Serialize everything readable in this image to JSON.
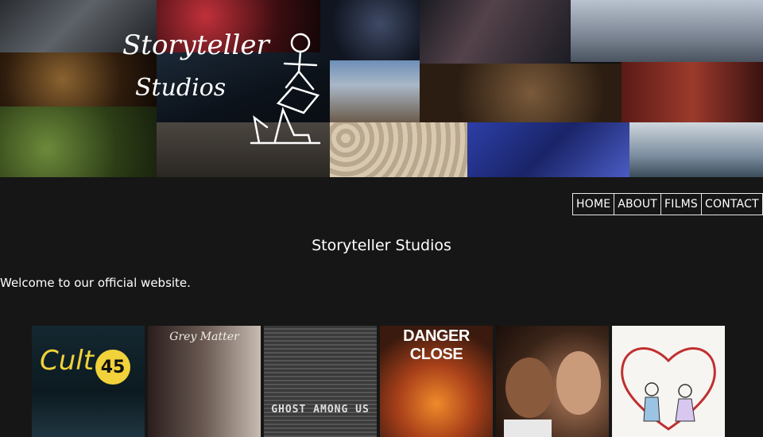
{
  "header": {
    "logo_line1": "Storyteller",
    "logo_line2": "Studios"
  },
  "nav": {
    "items": [
      {
        "label": "HOME"
      },
      {
        "label": "ABOUT"
      },
      {
        "label": "FILMS"
      },
      {
        "label": "CONTACT"
      }
    ]
  },
  "main": {
    "title": "Storyteller Studios",
    "welcome": "Welcome to our official website."
  },
  "films": [
    {
      "title": "Cult",
      "badge": "45"
    },
    {
      "title": "Grey Matter"
    },
    {
      "title": "GHOST AMONG US"
    },
    {
      "title": "DANGER CLOSE"
    },
    {
      "title": ""
    },
    {
      "title": ""
    }
  ]
}
